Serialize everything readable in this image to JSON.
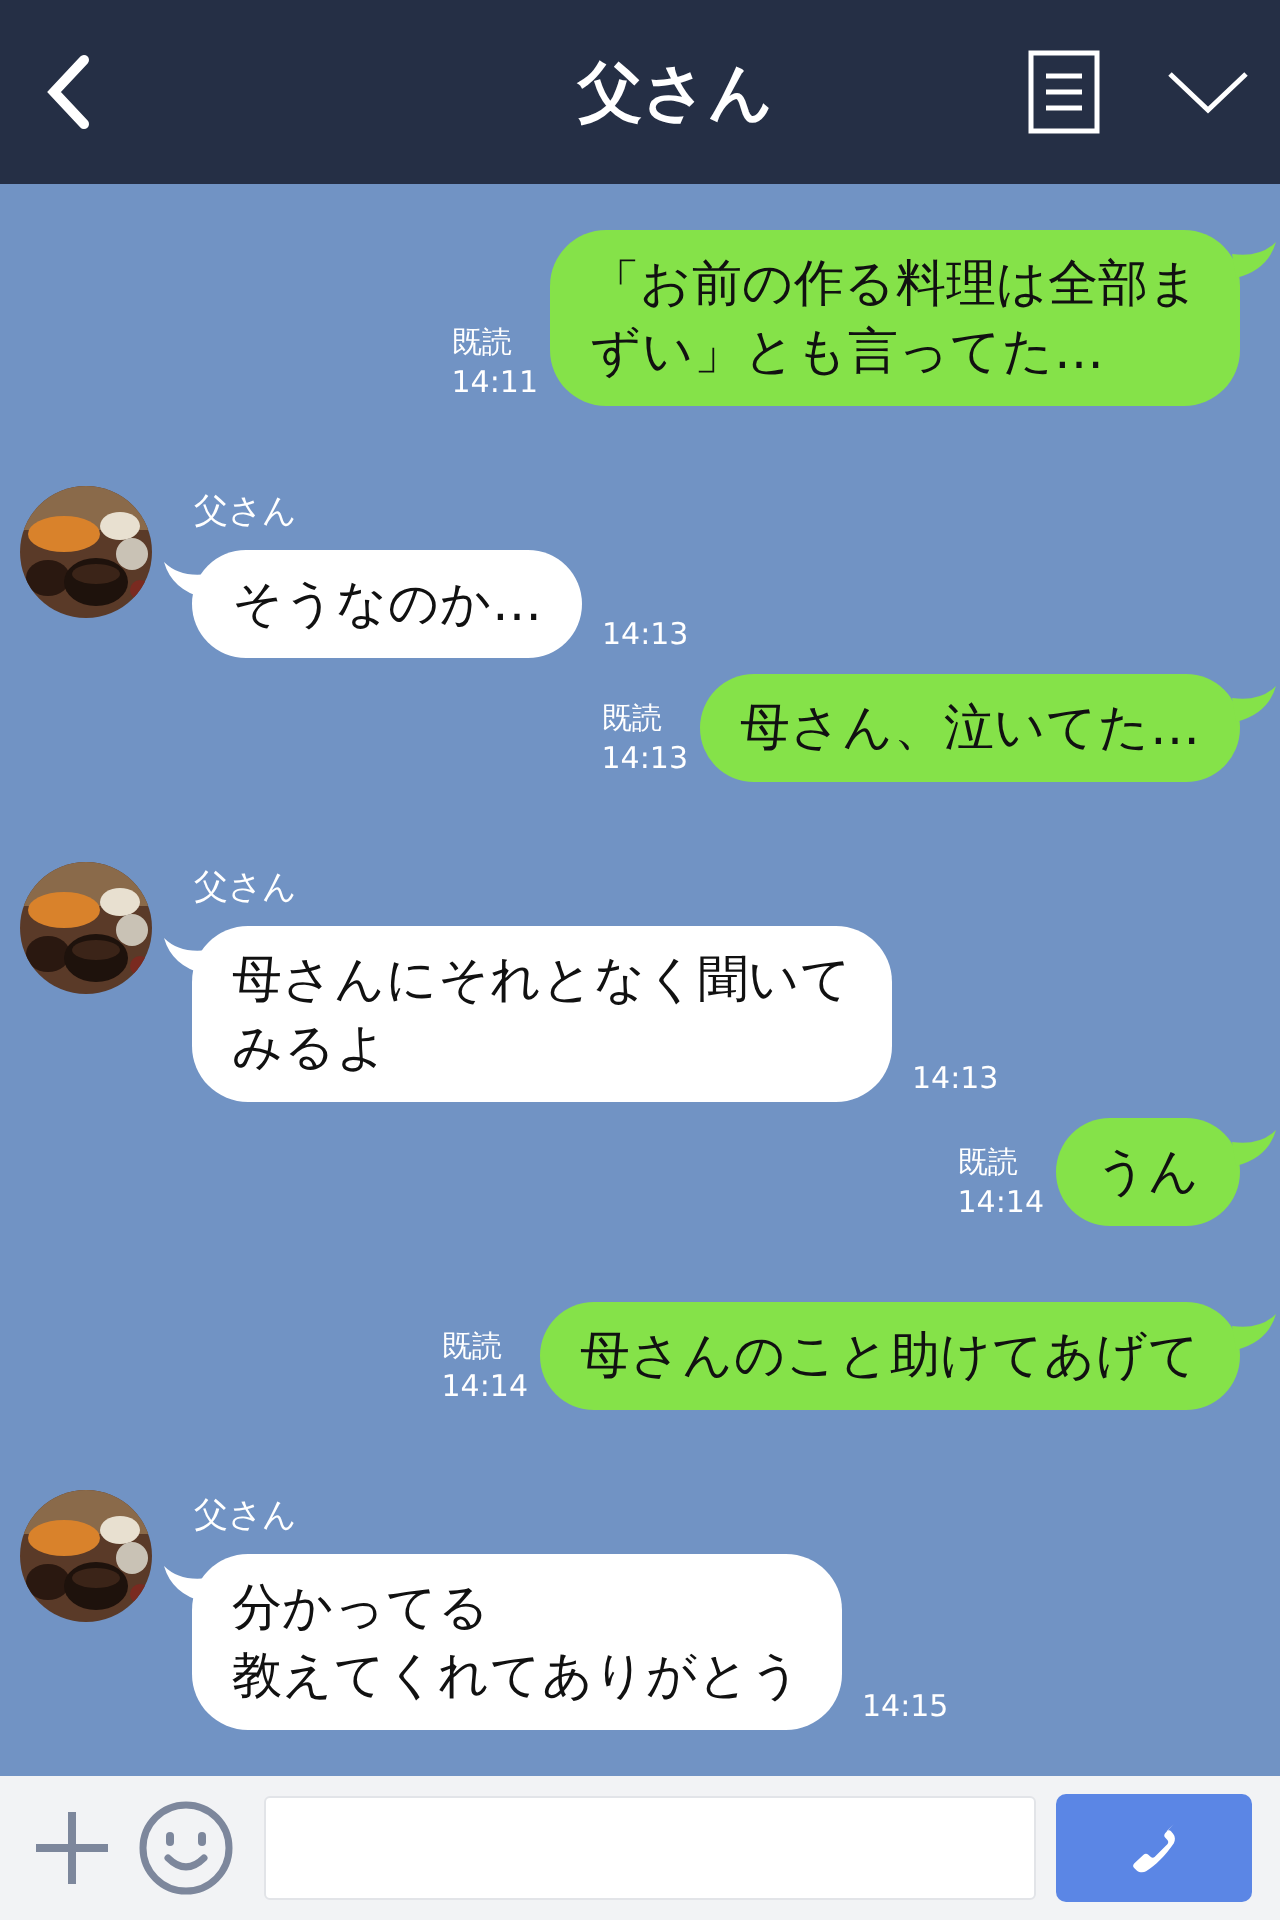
{
  "header": {
    "title": "父さん"
  },
  "messages": [
    {
      "kind": "sent",
      "lines": [
        "「お前の作る料理は全部ま",
        "ずい」とも言ってた…"
      ],
      "read": "既読",
      "time": "14:11"
    },
    {
      "kind": "received",
      "sender": "父さん",
      "avatar": {
        "kind": "picture"
      },
      "lines": [
        "そうなのか…"
      ],
      "time": "14:13"
    },
    {
      "kind": "sent",
      "lines": [
        "母さん、泣いてた…"
      ],
      "read": "既読",
      "time": "14:13"
    },
    {
      "kind": "received",
      "sender": "父さん",
      "avatar": {
        "kind": "picture"
      },
      "lines": [
        "母さんにそれとなく聞いて",
        "みるよ"
      ],
      "time": "14:13"
    },
    {
      "kind": "sent",
      "lines": [
        "うん"
      ],
      "read": "既読",
      "time": "14:14"
    },
    {
      "kind": "sent",
      "lines": [
        "母さんのこと助けてあげて"
      ],
      "read": "既読",
      "time": "14:14"
    },
    {
      "kind": "received",
      "sender": "父さん",
      "avatar": {
        "kind": "picture"
      },
      "lines": [
        "分かってる",
        "教えてくれてありがとう"
      ],
      "time": "14:15"
    }
  ]
}
